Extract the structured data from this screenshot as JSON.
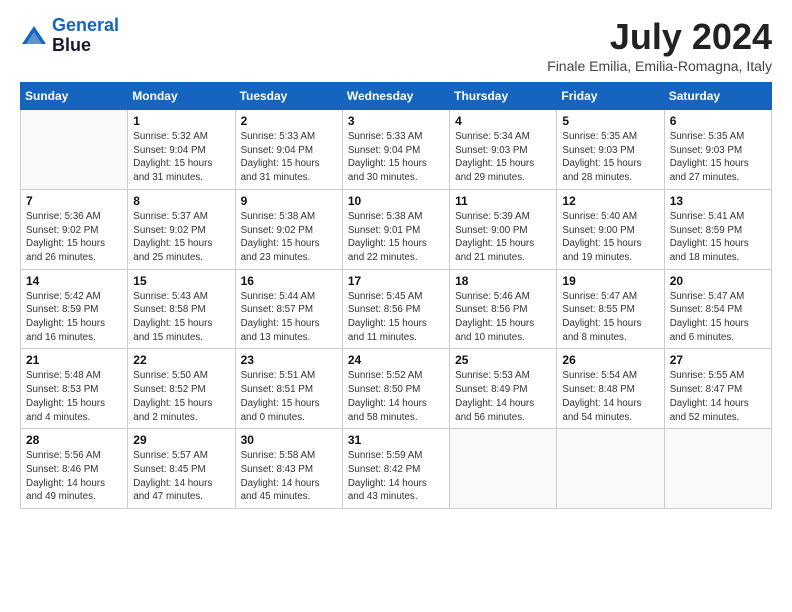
{
  "header": {
    "logo_line1": "General",
    "logo_line2": "Blue",
    "month_title": "July 2024",
    "location": "Finale Emilia, Emilia-Romagna, Italy"
  },
  "days_of_week": [
    "Sunday",
    "Monday",
    "Tuesday",
    "Wednesday",
    "Thursday",
    "Friday",
    "Saturday"
  ],
  "weeks": [
    [
      {
        "day": "",
        "info": ""
      },
      {
        "day": "1",
        "info": "Sunrise: 5:32 AM\nSunset: 9:04 PM\nDaylight: 15 hours\nand 31 minutes."
      },
      {
        "day": "2",
        "info": "Sunrise: 5:33 AM\nSunset: 9:04 PM\nDaylight: 15 hours\nand 31 minutes."
      },
      {
        "day": "3",
        "info": "Sunrise: 5:33 AM\nSunset: 9:04 PM\nDaylight: 15 hours\nand 30 minutes."
      },
      {
        "day": "4",
        "info": "Sunrise: 5:34 AM\nSunset: 9:03 PM\nDaylight: 15 hours\nand 29 minutes."
      },
      {
        "day": "5",
        "info": "Sunrise: 5:35 AM\nSunset: 9:03 PM\nDaylight: 15 hours\nand 28 minutes."
      },
      {
        "day": "6",
        "info": "Sunrise: 5:35 AM\nSunset: 9:03 PM\nDaylight: 15 hours\nand 27 minutes."
      }
    ],
    [
      {
        "day": "7",
        "info": "Sunrise: 5:36 AM\nSunset: 9:02 PM\nDaylight: 15 hours\nand 26 minutes."
      },
      {
        "day": "8",
        "info": "Sunrise: 5:37 AM\nSunset: 9:02 PM\nDaylight: 15 hours\nand 25 minutes."
      },
      {
        "day": "9",
        "info": "Sunrise: 5:38 AM\nSunset: 9:02 PM\nDaylight: 15 hours\nand 23 minutes."
      },
      {
        "day": "10",
        "info": "Sunrise: 5:38 AM\nSunset: 9:01 PM\nDaylight: 15 hours\nand 22 minutes."
      },
      {
        "day": "11",
        "info": "Sunrise: 5:39 AM\nSunset: 9:00 PM\nDaylight: 15 hours\nand 21 minutes."
      },
      {
        "day": "12",
        "info": "Sunrise: 5:40 AM\nSunset: 9:00 PM\nDaylight: 15 hours\nand 19 minutes."
      },
      {
        "day": "13",
        "info": "Sunrise: 5:41 AM\nSunset: 8:59 PM\nDaylight: 15 hours\nand 18 minutes."
      }
    ],
    [
      {
        "day": "14",
        "info": "Sunrise: 5:42 AM\nSunset: 8:59 PM\nDaylight: 15 hours\nand 16 minutes."
      },
      {
        "day": "15",
        "info": "Sunrise: 5:43 AM\nSunset: 8:58 PM\nDaylight: 15 hours\nand 15 minutes."
      },
      {
        "day": "16",
        "info": "Sunrise: 5:44 AM\nSunset: 8:57 PM\nDaylight: 15 hours\nand 13 minutes."
      },
      {
        "day": "17",
        "info": "Sunrise: 5:45 AM\nSunset: 8:56 PM\nDaylight: 15 hours\nand 11 minutes."
      },
      {
        "day": "18",
        "info": "Sunrise: 5:46 AM\nSunset: 8:56 PM\nDaylight: 15 hours\nand 10 minutes."
      },
      {
        "day": "19",
        "info": "Sunrise: 5:47 AM\nSunset: 8:55 PM\nDaylight: 15 hours\nand 8 minutes."
      },
      {
        "day": "20",
        "info": "Sunrise: 5:47 AM\nSunset: 8:54 PM\nDaylight: 15 hours\nand 6 minutes."
      }
    ],
    [
      {
        "day": "21",
        "info": "Sunrise: 5:48 AM\nSunset: 8:53 PM\nDaylight: 15 hours\nand 4 minutes."
      },
      {
        "day": "22",
        "info": "Sunrise: 5:50 AM\nSunset: 8:52 PM\nDaylight: 15 hours\nand 2 minutes."
      },
      {
        "day": "23",
        "info": "Sunrise: 5:51 AM\nSunset: 8:51 PM\nDaylight: 15 hours\nand 0 minutes."
      },
      {
        "day": "24",
        "info": "Sunrise: 5:52 AM\nSunset: 8:50 PM\nDaylight: 14 hours\nand 58 minutes."
      },
      {
        "day": "25",
        "info": "Sunrise: 5:53 AM\nSunset: 8:49 PM\nDaylight: 14 hours\nand 56 minutes."
      },
      {
        "day": "26",
        "info": "Sunrise: 5:54 AM\nSunset: 8:48 PM\nDaylight: 14 hours\nand 54 minutes."
      },
      {
        "day": "27",
        "info": "Sunrise: 5:55 AM\nSunset: 8:47 PM\nDaylight: 14 hours\nand 52 minutes."
      }
    ],
    [
      {
        "day": "28",
        "info": "Sunrise: 5:56 AM\nSunset: 8:46 PM\nDaylight: 14 hours\nand 49 minutes."
      },
      {
        "day": "29",
        "info": "Sunrise: 5:57 AM\nSunset: 8:45 PM\nDaylight: 14 hours\nand 47 minutes."
      },
      {
        "day": "30",
        "info": "Sunrise: 5:58 AM\nSunset: 8:43 PM\nDaylight: 14 hours\nand 45 minutes."
      },
      {
        "day": "31",
        "info": "Sunrise: 5:59 AM\nSunset: 8:42 PM\nDaylight: 14 hours\nand 43 minutes."
      },
      {
        "day": "",
        "info": ""
      },
      {
        "day": "",
        "info": ""
      },
      {
        "day": "",
        "info": ""
      }
    ]
  ]
}
